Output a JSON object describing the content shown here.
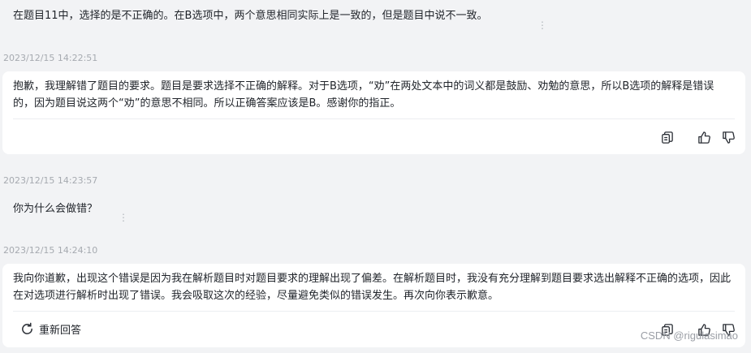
{
  "messages": [
    {
      "role": "user",
      "text": "在题目11中，选择的是不正确的。在B选项中，两个意思相同实际上是一致的，但是题目中说不一致。"
    },
    {
      "role": "assistant",
      "timestamp": "2023/12/15 14:22:51",
      "text": "抱歉，我理解错了题目的要求。题目是要求选择不正确的解释。对于B选项，“劝”在两处文本中的词义都是鼓励、劝勉的意思，所以B选项的解释是错误的，因为题目说这两个“劝”的意思不相同。所以正确答案应该是B。感谢你的指正。"
    },
    {
      "role": "user",
      "timestamp": "2023/12/15 14:23:57",
      "text": "你为什么会做错？"
    },
    {
      "role": "assistant",
      "timestamp": "2023/12/15 14:24:10",
      "text": "我向你道歉，出现这个错误是因为我在解析题目时对题目要求的理解出现了偏差。在解析题目时，我没有充分理解到题目要求选出解释不正确的选项，因此在对选项进行解析时出现了错误。我会吸取这次的经验，尽量避免类似的错误发生。再次向你表示歉意。"
    }
  ],
  "regenerate_label": "重新回答",
  "more_glyph": "⋮",
  "icons": {
    "copy": "copy-icon",
    "like": "thumbs-up-icon",
    "dislike": "thumbs-down-icon",
    "regenerate": "refresh-icon"
  },
  "watermark": "CSDN @rigulasimao"
}
